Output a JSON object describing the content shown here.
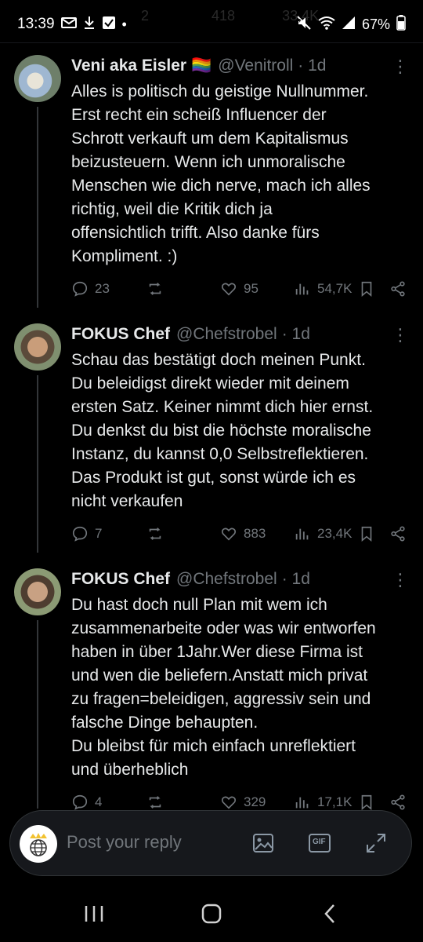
{
  "status": {
    "time": "13:39",
    "battery": "67%",
    "ghost_counts": [
      "2",
      "418",
      "33,4K"
    ]
  },
  "tweets": [
    {
      "name": "Veni aka Eisler",
      "emoji": "🏳️‍🌈",
      "handle": "@Venitroll",
      "time": "· 1d",
      "text": "Alles is politisch du geistige Nullnummer.\nErst recht ein scheiß Influencer der\nSchrott verkauft um dem Kapitalismus\nbeizusteuern. Wenn ich unmoralische\nMenschen wie dich nerve, mach ich alles\nrichtig, weil die Kritik dich ja\noffensichtlich trifft. Also danke fürs\nKompliment. :)",
      "replies": "23",
      "reposts": "",
      "likes": "95",
      "views": "54,7K"
    },
    {
      "name": "FOKUS Chef",
      "emoji": "",
      "handle": "@Chefstrobel",
      "time": "· 1d",
      "text": "Schau das bestätigt doch meinen Punkt.\nDu beleidigst direkt wieder mit deinem\nersten Satz. Keiner nimmt dich hier ernst.\nDu denkst du bist die höchste moralische\nInstanz, du kannst 0,0 Selbstreflektieren.\nDas Produkt ist gut, sonst würde ich es\nnicht verkaufen",
      "replies": "7",
      "reposts": "",
      "likes": "883",
      "views": "23,4K"
    },
    {
      "name": "FOKUS Chef",
      "emoji": "",
      "handle": "@Chefstrobel",
      "time": "· 1d",
      "text": "Du hast doch null Plan mit wem ich\nzusammenarbeite oder was wir entworfen\nhaben in über 1Jahr.Wer diese Firma ist\nund wen die beliefern.Anstatt mich privat\nzu fragen=beleidigen, aggressiv sein und\nfalsche Dinge behaupten.\nDu bleibst für mich einfach unreflektiert\nund überheblich",
      "replies": "4",
      "reposts": "",
      "likes": "329",
      "views": "17,1K"
    }
  ],
  "reply": {
    "placeholder": "Post your reply"
  },
  "icons": {
    "reply_avatar": "crown-globe-icon",
    "media": "image-icon",
    "gif": "gif-icon",
    "expand": "expand-icon"
  },
  "gif_label": "GIF",
  "colors": {
    "background": "#000000",
    "text": "#e7e9ea",
    "muted": "#71767b"
  }
}
